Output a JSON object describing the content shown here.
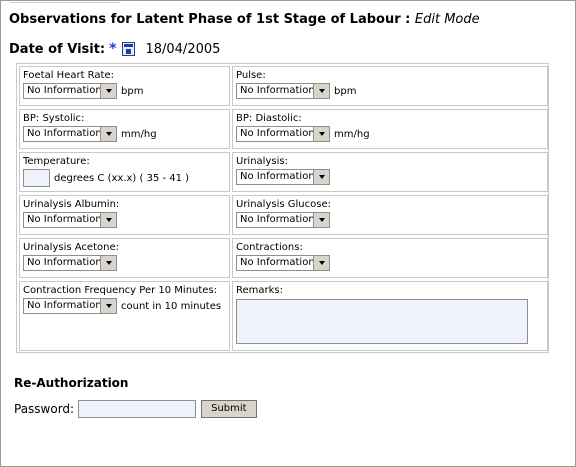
{
  "page": {
    "title": "Observations for Latent Phase of 1st Stage of Labour : ",
    "mode": "Edit Mode",
    "date_label": "Date of Visit:",
    "required_mark": "*",
    "date_value": "18/04/2005"
  },
  "fields": {
    "foetal_heart_rate": {
      "label": "Foetal Heart Rate:",
      "value": "No Information",
      "unit": "bpm"
    },
    "pulse": {
      "label": "Pulse:",
      "value": "No Information",
      "unit": "bpm"
    },
    "bp_systolic": {
      "label": "BP: Systolic:",
      "value": "No Information",
      "unit": "mm/hg"
    },
    "bp_diastolic": {
      "label": "BP: Diastolic:",
      "value": "No Information",
      "unit": "mm/hg"
    },
    "temperature": {
      "label": "Temperature:",
      "value": "",
      "unit": "degrees C (xx.x) ( 35 - 41 )"
    },
    "urinalysis": {
      "label": "Urinalysis:",
      "value": "No Information"
    },
    "urinalysis_albumin": {
      "label": "Urinalysis Albumin:",
      "value": "No Information"
    },
    "urinalysis_glucose": {
      "label": "Urinalysis Glucose:",
      "value": "No Information"
    },
    "urinalysis_acetone": {
      "label": "Urinalysis Acetone:",
      "value": "No Information"
    },
    "contractions": {
      "label": "Contractions:",
      "value": "No Information"
    },
    "contraction_frequency": {
      "label": "Contraction Frequency Per 10 Minutes:",
      "value": "No Information",
      "unit": "count in 10 minutes"
    },
    "remarks": {
      "label": "Remarks:",
      "value": ""
    }
  },
  "reauth": {
    "heading": "Re-Authorization",
    "password_label": "Password:",
    "submit_label": "Submit"
  },
  "icons": {
    "calendar": "calendar-icon",
    "dropdown": "chevron-down-icon"
  }
}
